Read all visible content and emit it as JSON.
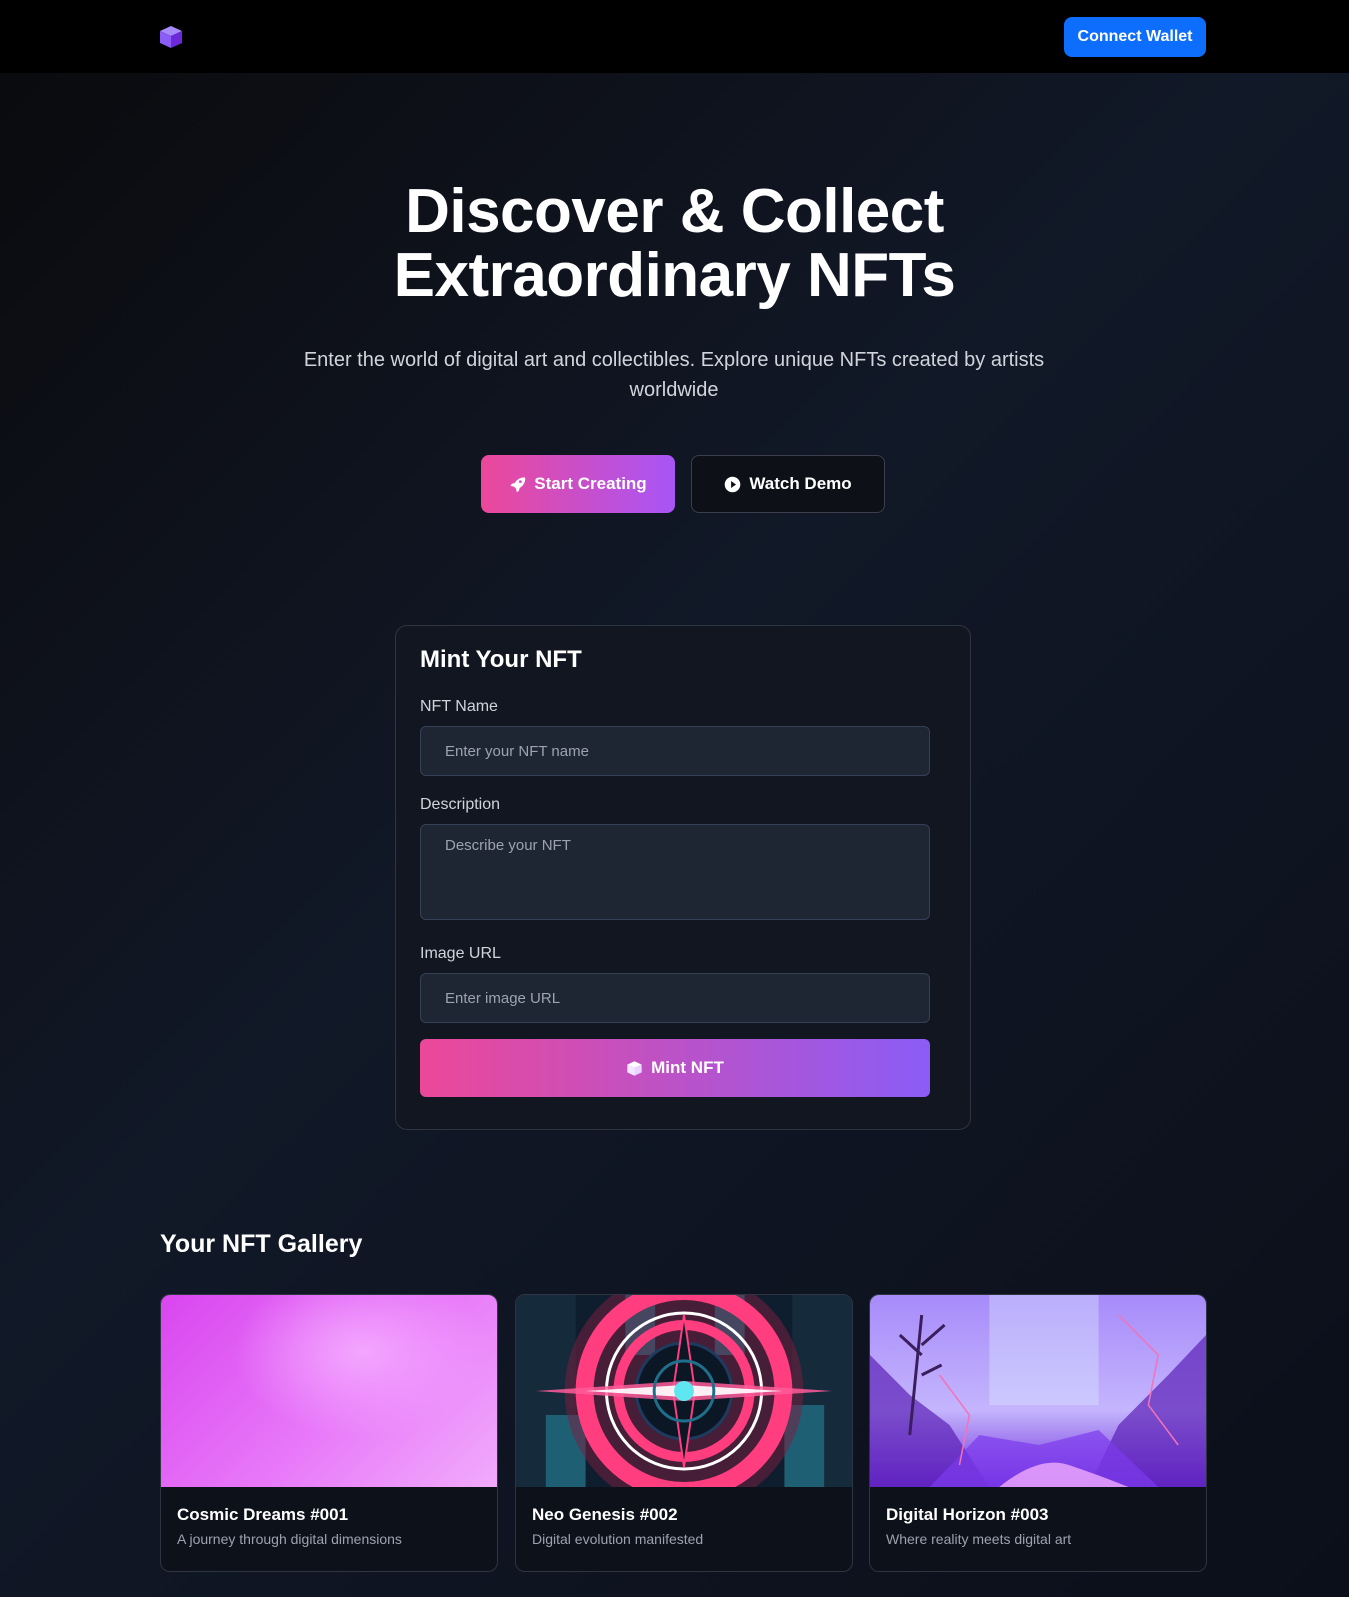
{
  "nav": {
    "logo_icon": "cube-icon",
    "connect_label": "Connect Wallet"
  },
  "hero": {
    "title_line1": "Discover & Collect",
    "title_line2": "Extraordinary NFTs",
    "subtitle": "Enter the world of digital art and collectibles. Explore unique NFTs created by artists worldwide",
    "start_label": "Start Creating",
    "start_icon": "rocket-icon",
    "demo_label": "Watch Demo",
    "demo_icon": "play-circle-icon"
  },
  "mint": {
    "title": "Mint Your NFT",
    "name_label": "NFT Name",
    "name_placeholder": "Enter your NFT name",
    "desc_label": "Description",
    "desc_placeholder": "Describe your NFT",
    "image_label": "Image URL",
    "image_placeholder": "Enter image URL",
    "button_label": "Mint NFT",
    "button_icon": "cube-icon"
  },
  "gallery": {
    "title": "Your NFT Gallery",
    "items": [
      {
        "name": "Cosmic Dreams #001",
        "description": "A journey through digital dimensions"
      },
      {
        "name": "Neo Genesis #002",
        "description": "Digital evolution manifested"
      },
      {
        "name": "Digital Horizon #003",
        "description": "Where reality meets digital art"
      }
    ]
  },
  "colors": {
    "accent_blue": "#0d6efd",
    "gradient_start": "#ec4899",
    "gradient_end": "#a855f7"
  }
}
